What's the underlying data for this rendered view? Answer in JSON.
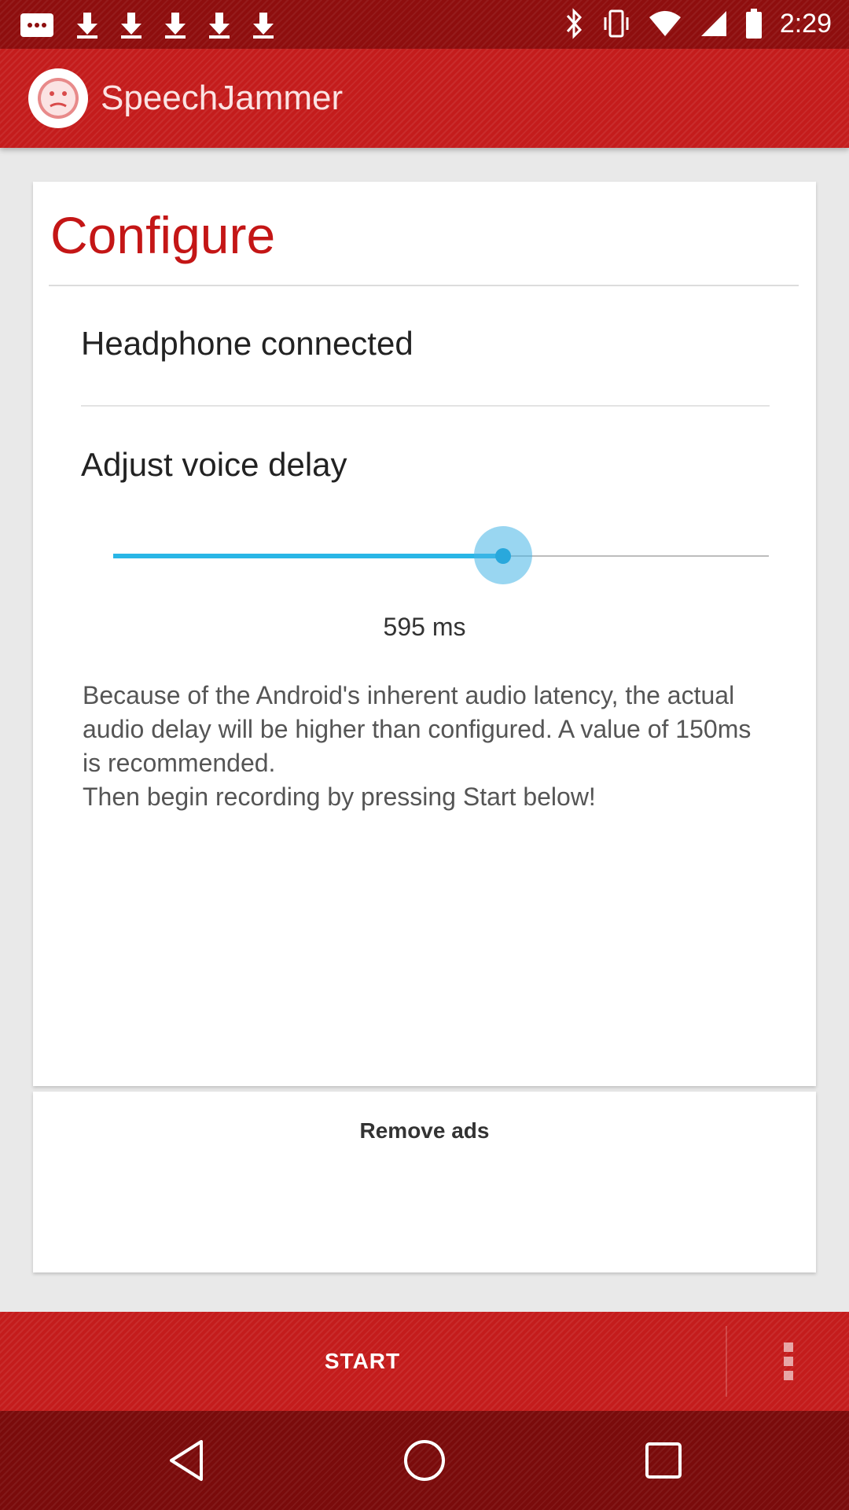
{
  "status_bar": {
    "time": "2:29",
    "icons": [
      "message-icon",
      "download-icon",
      "download-icon",
      "download-icon",
      "download-icon",
      "download-icon",
      "bluetooth-icon",
      "vibrate-icon",
      "wifi-icon",
      "signal-icon",
      "battery-icon"
    ]
  },
  "app_bar": {
    "title": "SpeechJammer",
    "logo_icon": "sad-face-icon"
  },
  "configure": {
    "title": "Configure",
    "headphone_status": "Headphone connected",
    "delay_label": "Adjust voice delay",
    "delay_value": "595 ms",
    "slider_fraction": 0.595,
    "info_text": "Because of the Android's inherent audio latency, the actual audio delay will be higher than configured. A value of 150ms is recommended.\nThen begin recording by pressing Start below!"
  },
  "ads": {
    "remove_label": "Remove ads"
  },
  "bottom_bar": {
    "start_label": "START",
    "more_icon": "more-vert-icon"
  },
  "nav_bar": {
    "icons": [
      "back-icon",
      "home-icon",
      "recents-icon"
    ]
  },
  "colors": {
    "accent_red": "#c41c1c",
    "slider_blue": "#29b6e6"
  }
}
